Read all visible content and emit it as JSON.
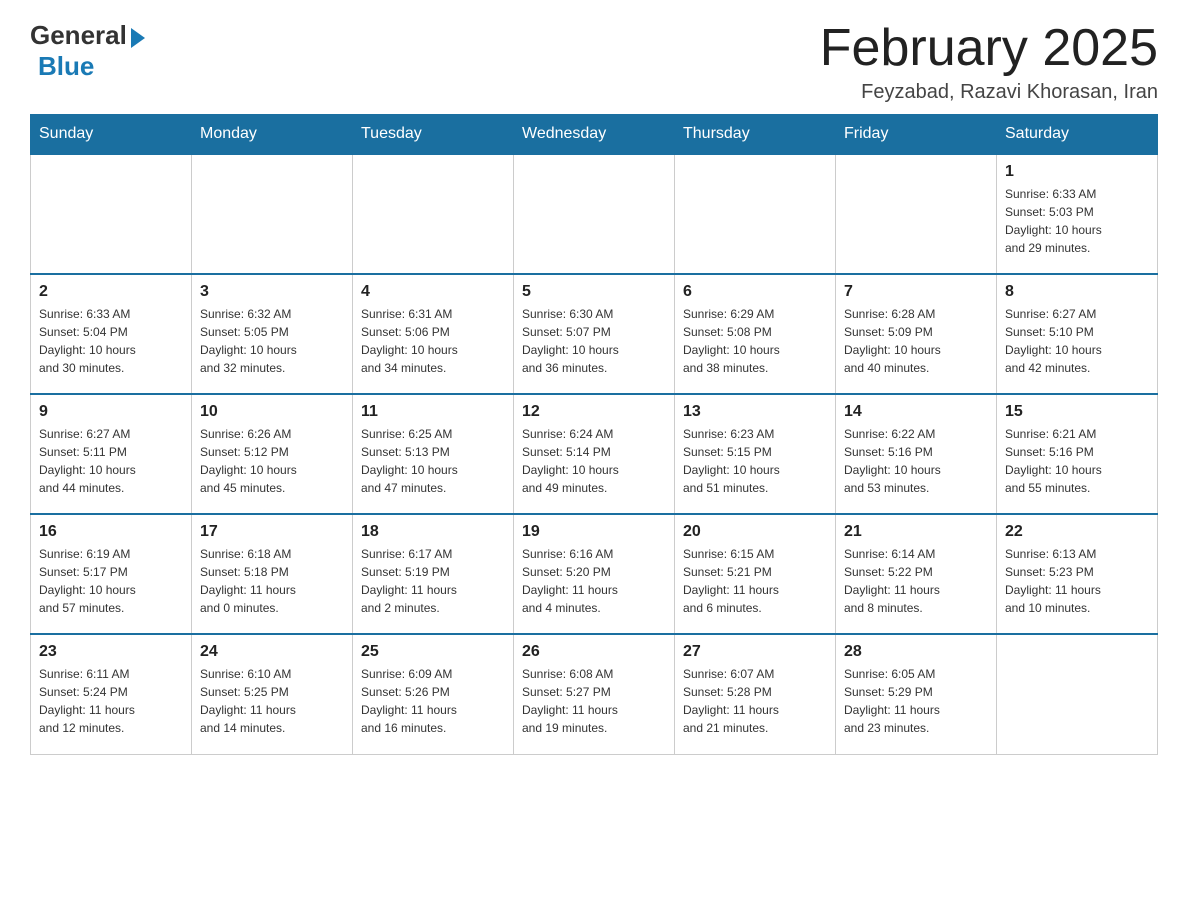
{
  "header": {
    "logo_general": "General",
    "logo_blue": "Blue",
    "title": "February 2025",
    "location": "Feyzabad, Razavi Khorasan, Iran"
  },
  "days_of_week": [
    "Sunday",
    "Monday",
    "Tuesday",
    "Wednesday",
    "Thursday",
    "Friday",
    "Saturday"
  ],
  "weeks": [
    [
      {
        "day": "",
        "info": ""
      },
      {
        "day": "",
        "info": ""
      },
      {
        "day": "",
        "info": ""
      },
      {
        "day": "",
        "info": ""
      },
      {
        "day": "",
        "info": ""
      },
      {
        "day": "",
        "info": ""
      },
      {
        "day": "1",
        "info": "Sunrise: 6:33 AM\nSunset: 5:03 PM\nDaylight: 10 hours\nand 29 minutes."
      }
    ],
    [
      {
        "day": "2",
        "info": "Sunrise: 6:33 AM\nSunset: 5:04 PM\nDaylight: 10 hours\nand 30 minutes."
      },
      {
        "day": "3",
        "info": "Sunrise: 6:32 AM\nSunset: 5:05 PM\nDaylight: 10 hours\nand 32 minutes."
      },
      {
        "day": "4",
        "info": "Sunrise: 6:31 AM\nSunset: 5:06 PM\nDaylight: 10 hours\nand 34 minutes."
      },
      {
        "day": "5",
        "info": "Sunrise: 6:30 AM\nSunset: 5:07 PM\nDaylight: 10 hours\nand 36 minutes."
      },
      {
        "day": "6",
        "info": "Sunrise: 6:29 AM\nSunset: 5:08 PM\nDaylight: 10 hours\nand 38 minutes."
      },
      {
        "day": "7",
        "info": "Sunrise: 6:28 AM\nSunset: 5:09 PM\nDaylight: 10 hours\nand 40 minutes."
      },
      {
        "day": "8",
        "info": "Sunrise: 6:27 AM\nSunset: 5:10 PM\nDaylight: 10 hours\nand 42 minutes."
      }
    ],
    [
      {
        "day": "9",
        "info": "Sunrise: 6:27 AM\nSunset: 5:11 PM\nDaylight: 10 hours\nand 44 minutes."
      },
      {
        "day": "10",
        "info": "Sunrise: 6:26 AM\nSunset: 5:12 PM\nDaylight: 10 hours\nand 45 minutes."
      },
      {
        "day": "11",
        "info": "Sunrise: 6:25 AM\nSunset: 5:13 PM\nDaylight: 10 hours\nand 47 minutes."
      },
      {
        "day": "12",
        "info": "Sunrise: 6:24 AM\nSunset: 5:14 PM\nDaylight: 10 hours\nand 49 minutes."
      },
      {
        "day": "13",
        "info": "Sunrise: 6:23 AM\nSunset: 5:15 PM\nDaylight: 10 hours\nand 51 minutes."
      },
      {
        "day": "14",
        "info": "Sunrise: 6:22 AM\nSunset: 5:16 PM\nDaylight: 10 hours\nand 53 minutes."
      },
      {
        "day": "15",
        "info": "Sunrise: 6:21 AM\nSunset: 5:16 PM\nDaylight: 10 hours\nand 55 minutes."
      }
    ],
    [
      {
        "day": "16",
        "info": "Sunrise: 6:19 AM\nSunset: 5:17 PM\nDaylight: 10 hours\nand 57 minutes."
      },
      {
        "day": "17",
        "info": "Sunrise: 6:18 AM\nSunset: 5:18 PM\nDaylight: 11 hours\nand 0 minutes."
      },
      {
        "day": "18",
        "info": "Sunrise: 6:17 AM\nSunset: 5:19 PM\nDaylight: 11 hours\nand 2 minutes."
      },
      {
        "day": "19",
        "info": "Sunrise: 6:16 AM\nSunset: 5:20 PM\nDaylight: 11 hours\nand 4 minutes."
      },
      {
        "day": "20",
        "info": "Sunrise: 6:15 AM\nSunset: 5:21 PM\nDaylight: 11 hours\nand 6 minutes."
      },
      {
        "day": "21",
        "info": "Sunrise: 6:14 AM\nSunset: 5:22 PM\nDaylight: 11 hours\nand 8 minutes."
      },
      {
        "day": "22",
        "info": "Sunrise: 6:13 AM\nSunset: 5:23 PM\nDaylight: 11 hours\nand 10 minutes."
      }
    ],
    [
      {
        "day": "23",
        "info": "Sunrise: 6:11 AM\nSunset: 5:24 PM\nDaylight: 11 hours\nand 12 minutes."
      },
      {
        "day": "24",
        "info": "Sunrise: 6:10 AM\nSunset: 5:25 PM\nDaylight: 11 hours\nand 14 minutes."
      },
      {
        "day": "25",
        "info": "Sunrise: 6:09 AM\nSunset: 5:26 PM\nDaylight: 11 hours\nand 16 minutes."
      },
      {
        "day": "26",
        "info": "Sunrise: 6:08 AM\nSunset: 5:27 PM\nDaylight: 11 hours\nand 19 minutes."
      },
      {
        "day": "27",
        "info": "Sunrise: 6:07 AM\nSunset: 5:28 PM\nDaylight: 11 hours\nand 21 minutes."
      },
      {
        "day": "28",
        "info": "Sunrise: 6:05 AM\nSunset: 5:29 PM\nDaylight: 11 hours\nand 23 minutes."
      },
      {
        "day": "",
        "info": ""
      }
    ]
  ]
}
